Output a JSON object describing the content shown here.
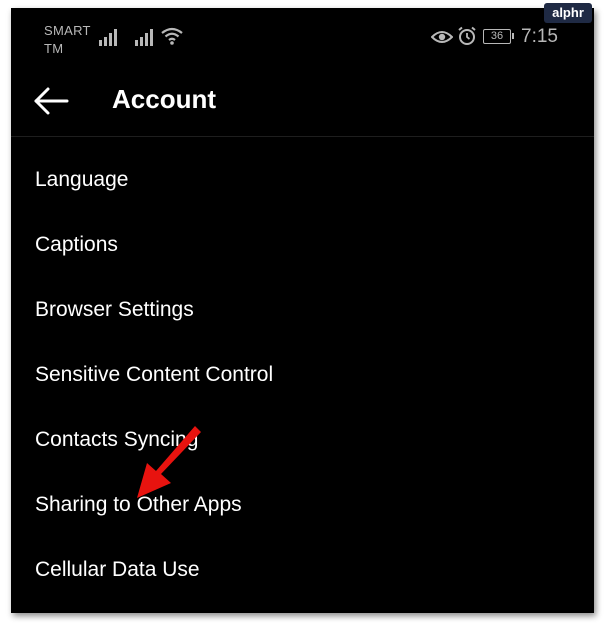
{
  "status_bar": {
    "carrier": "SMART TM",
    "battery": "36",
    "time": "7:15"
  },
  "header": {
    "title": "Account"
  },
  "menu": {
    "items": [
      {
        "label": "Language"
      },
      {
        "label": "Captions"
      },
      {
        "label": "Browser Settings"
      },
      {
        "label": "Sensitive Content Control"
      },
      {
        "label": "Contacts Syncing"
      },
      {
        "label": "Sharing to Other Apps"
      },
      {
        "label": "Cellular Data Use"
      }
    ]
  },
  "watermark": {
    "text": "alphr"
  },
  "annotation": {
    "arrow_color": "#e8130f"
  },
  "icons": {
    "back": "back-arrow-icon",
    "signal": "signal-icon",
    "wifi": "wifi-icon",
    "eye": "eye-icon",
    "alarm": "alarm-icon"
  }
}
